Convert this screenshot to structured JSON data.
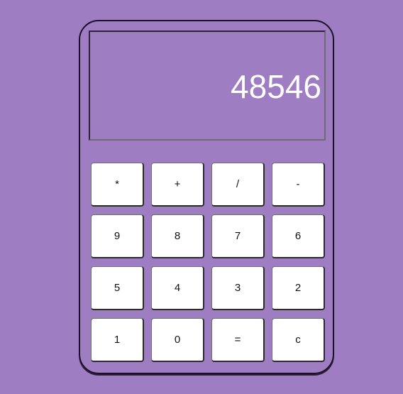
{
  "display": {
    "value": "48546"
  },
  "keys": [
    {
      "label": "*",
      "name": "multiply-key"
    },
    {
      "label": "+",
      "name": "add-key"
    },
    {
      "label": "/",
      "name": "divide-key"
    },
    {
      "label": "-",
      "name": "subtract-key"
    },
    {
      "label": "9",
      "name": "digit-9-key"
    },
    {
      "label": "8",
      "name": "digit-8-key"
    },
    {
      "label": "7",
      "name": "digit-7-key"
    },
    {
      "label": "6",
      "name": "digit-6-key"
    },
    {
      "label": "5",
      "name": "digit-5-key"
    },
    {
      "label": "4",
      "name": "digit-4-key"
    },
    {
      "label": "3",
      "name": "digit-3-key"
    },
    {
      "label": "2",
      "name": "digit-2-key"
    },
    {
      "label": "1",
      "name": "digit-1-key"
    },
    {
      "label": "0",
      "name": "digit-0-key"
    },
    {
      "label": "=",
      "name": "equals-key"
    },
    {
      "label": "c",
      "name": "clear-key"
    }
  ],
  "colors": {
    "background": "#9e7dc3",
    "display_text": "#ffffff",
    "key_face": "#ffffff"
  }
}
